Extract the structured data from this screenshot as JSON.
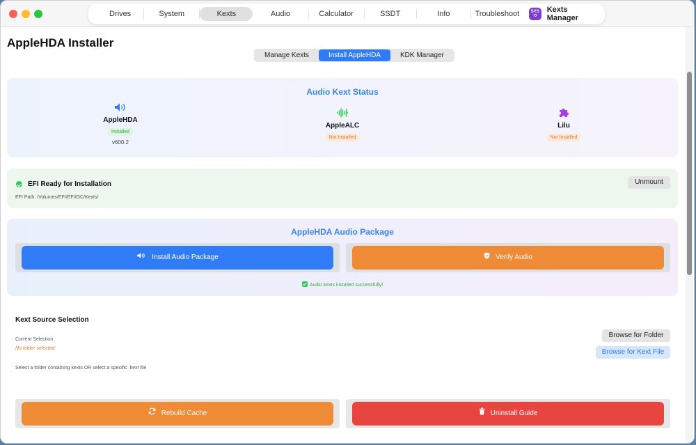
{
  "window": {
    "nav_tabs": [
      "Drives",
      "System",
      "Kexts",
      "Audio",
      "Calculator",
      "SSDT",
      "Info",
      "Troubleshoot"
    ],
    "active_tab": "Kexts",
    "brand": {
      "logo_text": "SYS\n⟲",
      "name": "Kexts Manager"
    }
  },
  "page": {
    "title": "AppleHDA Installer",
    "segments": [
      "Manage Kexts",
      "Install AppleHDA",
      "KDK Manager"
    ],
    "active_segment": "Install AppleHDA"
  },
  "status": {
    "heading": "Audio Kext Status",
    "kexts": [
      {
        "icon": "speaker-icon",
        "name": "AppleHDA",
        "badge": "Installed",
        "badge_color": "green",
        "version": "v600.2"
      },
      {
        "icon": "waveform-icon",
        "name": "AppleALC",
        "badge": "Not Installed",
        "badge_color": "orange"
      },
      {
        "icon": "puzzle-icon",
        "name": "Lilu",
        "badge": "Not Installed",
        "badge_color": "orange"
      }
    ]
  },
  "efi": {
    "title": "EFI Ready for Installation",
    "path": "EFI Path: /Volumes/EFI/EFI/OC/Kexts/",
    "unmount_label": "Unmount"
  },
  "audio_package": {
    "heading": "AppleHDA Audio Package",
    "install_label": "Install Audio Package",
    "verify_label": "Verify Audio",
    "success": "Audio kexts installed successfully!"
  },
  "source": {
    "title": "Kext Source Selection",
    "current_label": "Current Selection:",
    "current_value": "No folder selected",
    "help": "Select a folder containing kexts OR select a specific .kext file",
    "browse_folder_label": "Browse for Folder",
    "browse_file_label": "Browse for Kext File"
  },
  "actions": {
    "rebuild_label": "Rebuild Cache",
    "uninstall_label": "Uninstall Guide"
  },
  "colors": {
    "accent_blue": "#2f7cf6",
    "orange": "#ef8a37",
    "red": "#e84440",
    "success_green": "#34c759"
  }
}
